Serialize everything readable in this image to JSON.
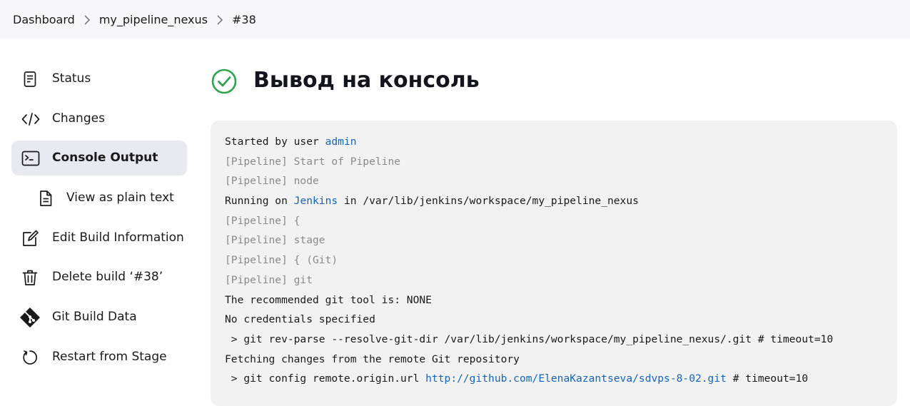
{
  "breadcrumb": {
    "items": [
      "Dashboard",
      "my_pipeline_nexus",
      "#38"
    ]
  },
  "sidebar": {
    "items": [
      {
        "label": "Status",
        "icon": "document-icon"
      },
      {
        "label": "Changes",
        "icon": "code-icon"
      },
      {
        "label": "Console Output",
        "icon": "terminal-icon",
        "active": true
      },
      {
        "label": "View as plain text",
        "icon": "file-icon"
      },
      {
        "label": "Edit Build Information",
        "icon": "edit-icon"
      },
      {
        "label": "Delete build ‘#38’",
        "icon": "trash-icon"
      },
      {
        "label": "Git Build Data",
        "icon": "git-icon"
      },
      {
        "label": "Restart from Stage",
        "icon": "restart-icon"
      }
    ]
  },
  "main": {
    "title": "Вывод на консоль",
    "status": "success"
  },
  "console": {
    "lines": [
      {
        "parts": [
          {
            "text": "Started by user "
          },
          {
            "text": "admin",
            "link": true
          }
        ]
      },
      {
        "parts": [
          {
            "text": "[Pipeline] Start of Pipeline"
          }
        ],
        "muted": true
      },
      {
        "parts": [
          {
            "text": "[Pipeline] node"
          }
        ],
        "muted": true
      },
      {
        "parts": [
          {
            "text": "Running on "
          },
          {
            "text": "Jenkins",
            "link": true
          },
          {
            "text": " in /var/lib/jenkins/workspace/my_pipeline_nexus"
          }
        ]
      },
      {
        "parts": [
          {
            "text": "[Pipeline] {"
          }
        ],
        "muted": true
      },
      {
        "parts": [
          {
            "text": "[Pipeline] stage"
          }
        ],
        "muted": true
      },
      {
        "parts": [
          {
            "text": "[Pipeline] { (Git)"
          }
        ],
        "muted": true
      },
      {
        "parts": [
          {
            "text": "[Pipeline] git"
          }
        ],
        "muted": true
      },
      {
        "parts": [
          {
            "text": "The recommended git tool is: NONE"
          }
        ]
      },
      {
        "parts": [
          {
            "text": "No credentials specified"
          }
        ]
      },
      {
        "parts": [
          {
            "text": " > git rev-parse --resolve-git-dir /var/lib/jenkins/workspace/my_pipeline_nexus/.git # timeout=10"
          }
        ]
      },
      {
        "parts": [
          {
            "text": "Fetching changes from the remote Git repository"
          }
        ]
      },
      {
        "parts": [
          {
            "text": " > git config remote.origin.url "
          },
          {
            "text": "http://github.com/ElenaKazantseva/sdvps-8-02.git",
            "link": true
          },
          {
            "text": " # timeout=10"
          }
        ]
      }
    ]
  },
  "colors": {
    "accent_success": "#2ea44f",
    "link": "#1565c0",
    "muted": "#8a8a8a",
    "console_bg": "#f2f2f2",
    "active_item_bg": "#e9e9f0"
  }
}
